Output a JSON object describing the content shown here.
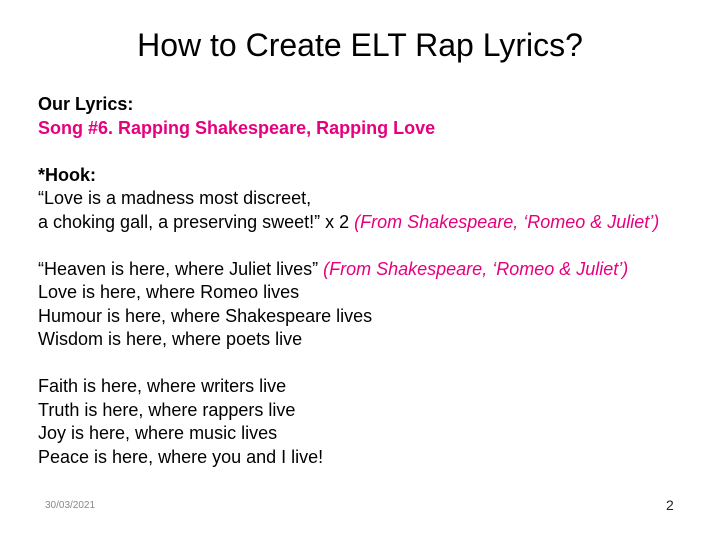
{
  "slide": {
    "title": "How to Create ELT Rap Lyrics?",
    "heading": "Our Lyrics:",
    "song": "Song #6. Rapping Shakespeare, Rapping Love",
    "hook_label": "*Hook:",
    "hook_line1": "“Love is a madness most discreet,",
    "hook_line2a": "a choking gall, a preserving sweet!” x 2 ",
    "hook_source": "(From Shakespeare, ‘Romeo & Juliet’)",
    "verse1_line1a": "“Heaven is here, where Juliet lives” ",
    "verse1_source": "(From Shakespeare, ‘Romeo & Juliet’)",
    "verse1_line2": "Love is here, where Romeo lives",
    "verse1_line3": "Humour is here, where Shakespeare lives",
    "verse1_line4": "Wisdom is here, where poets live",
    "verse2_line1": "Faith is here, where writers live",
    "verse2_line2": "Truth is here, where rappers live",
    "verse2_line3": "Joy is here, where music lives",
    "verse2_line4": "Peace is here, where you and I live!",
    "footer_date": "30/03/2021",
    "page_number": "2"
  },
  "colors": {
    "accent": "#e6007e",
    "text": "#000000"
  }
}
